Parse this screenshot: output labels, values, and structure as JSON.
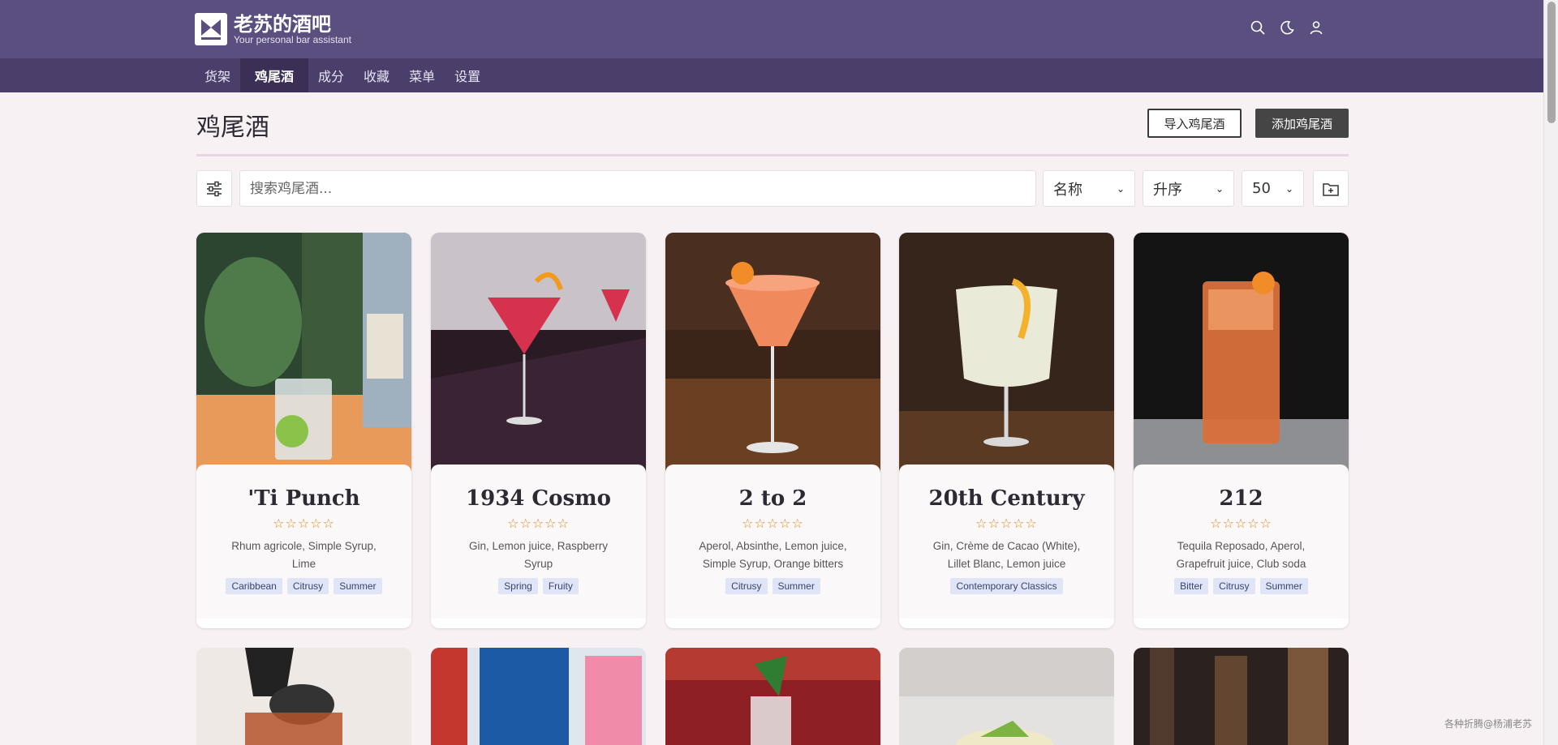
{
  "app": {
    "title": "老苏的酒吧",
    "subtitle": "Your personal bar assistant"
  },
  "header_icons": [
    "search-icon",
    "moon-icon",
    "user-icon"
  ],
  "nav": {
    "items": [
      {
        "label": "货架",
        "active": false
      },
      {
        "label": "鸡尾酒",
        "active": true
      },
      {
        "label": "成分",
        "active": false
      },
      {
        "label": "收藏",
        "active": false
      },
      {
        "label": "菜单",
        "active": false
      },
      {
        "label": "设置",
        "active": false
      }
    ]
  },
  "page": {
    "title": "鸡尾酒",
    "import_label": "导入鸡尾酒",
    "add_label": "添加鸡尾酒"
  },
  "toolbar": {
    "search_placeholder": "搜索鸡尾酒...",
    "sort_value": "名称",
    "order_value": "升序",
    "limit_value": "50"
  },
  "cocktails": [
    {
      "name": "'Ti Punch",
      "stars": "☆☆☆☆☆",
      "ingredients": "Rhum agricole, Simple Syrup, Lime",
      "tags": [
        "Caribbean",
        "Citrusy",
        "Summer"
      ]
    },
    {
      "name": "1934 Cosmo",
      "stars": "☆☆☆☆☆",
      "ingredients": "Gin, Lemon juice, Raspberry Syrup",
      "tags": [
        "Spring",
        "Fruity"
      ]
    },
    {
      "name": "2 to 2",
      "stars": "☆☆☆☆☆",
      "ingredients": "Aperol, Absinthe, Lemon juice, Simple Syrup, Orange bitters",
      "tags": [
        "Citrusy",
        "Summer"
      ]
    },
    {
      "name": "20th Century",
      "stars": "☆☆☆☆☆",
      "ingredients": "Gin, Crème de Cacao (White), Lillet Blanc, Lemon juice",
      "tags": [
        "Contemporary Classics"
      ]
    },
    {
      "name": "212",
      "stars": "☆☆☆☆☆",
      "ingredients": "Tequila Reposado, Aperol, Grapefruit juice, Club soda",
      "tags": [
        "Bitter",
        "Citrusy",
        "Summer"
      ]
    }
  ],
  "watermark": "各种折腾@杨浦老苏",
  "colors": {
    "header": "#5a4f7f",
    "nav": "#4b3e6a",
    "nav_active": "#3b2f55",
    "page_bg": "#f8f1f4",
    "star": "#d58a22",
    "tag_bg": "#dfe5f7"
  }
}
